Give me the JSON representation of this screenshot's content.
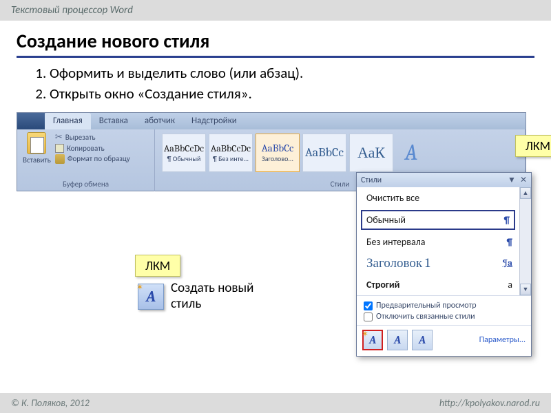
{
  "topbar": "Текстовый процессор Word",
  "title": "Создание нового стиля",
  "steps": [
    "Оформить и выделить слово (или абзац).",
    "Открыть окно «Создание стиля»."
  ],
  "ribbon": {
    "tabs": [
      "Главная",
      "Вставка",
      "аботчик",
      "Надстройки"
    ],
    "clipboard": {
      "paste": "Вставить",
      "cut": "Вырезать",
      "copy": "Копировать",
      "format": "Формат по образцу",
      "group": "Буфер обмена"
    },
    "styles": {
      "items": [
        {
          "sample": "AaBbCcDc",
          "name": "¶ Обычный"
        },
        {
          "sample": "AaBbCcDc",
          "name": "¶ Без инте..."
        },
        {
          "sample": "AaBbCc",
          "name": "Заголово..."
        },
        {
          "sample": "AaBbCc",
          "name": ""
        },
        {
          "sample": "АаК",
          "name": ""
        }
      ],
      "group": "Стили"
    }
  },
  "lkm": "ЛКМ",
  "create": {
    "label": "Создать новый\nстиль"
  },
  "panel": {
    "title": "Стили",
    "clear": "Очистить все",
    "items": [
      {
        "name": "Обычный",
        "mark": "¶"
      },
      {
        "name": "Без интервала",
        "mark": "¶"
      },
      {
        "name": "Заголовок 1",
        "mark": "¶a"
      },
      {
        "name": "Строгий",
        "mark": "a"
      }
    ],
    "preview": "Предварительный просмотр",
    "linked": "Отключить связанные стили",
    "params": "Параметры..."
  },
  "footer": {
    "left": "© К. Поляков, 2012",
    "right": "http://kpolyakov.narod.ru"
  }
}
